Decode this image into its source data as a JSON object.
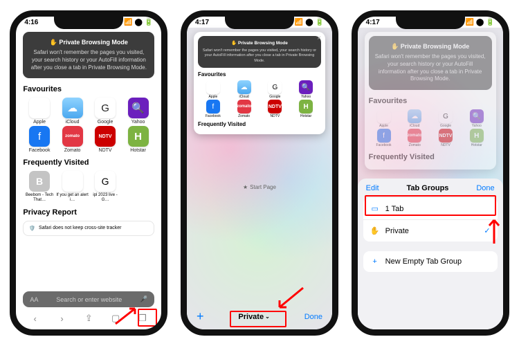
{
  "phone1": {
    "time": "4:16",
    "pbm": {
      "title": "✋ Private Browsing Mode",
      "body": "Safari won't remember the pages you visited, your search history or your AutoFill information after you close a tab in Private Browsing Mode."
    },
    "favourites_heading": "Favourites",
    "favourites": [
      {
        "label": "Apple",
        "glyph": ""
      },
      {
        "label": "iCloud",
        "glyph": "☁"
      },
      {
        "label": "Google",
        "glyph": "G"
      },
      {
        "label": "Yahoo",
        "glyph": "🔍"
      },
      {
        "label": "Facebook",
        "glyph": "f"
      },
      {
        "label": "Zomato",
        "glyph": "zomato"
      },
      {
        "label": "NDTV",
        "glyph": "NDTV"
      },
      {
        "label": "Hotstar",
        "glyph": "H"
      }
    ],
    "freq_heading": "Frequently Visited",
    "freq": [
      {
        "label": "Beebom - Tech That…",
        "glyph": "B"
      },
      {
        "label": "If you get an alert i…",
        "glyph": ""
      },
      {
        "label": "ipl 2023 live - G…",
        "glyph": "G"
      }
    ],
    "privacy_heading": "Privacy Report",
    "privacy_row": "Safari does not keep cross-site tracker",
    "search_placeholder": "Search or enter website"
  },
  "phone2": {
    "time": "4:17",
    "pbm": {
      "title": "✋ Private Browsing Mode",
      "body": "Safari won't remember the pages you visited, your search history or your AutoFill information after you close a tab in Private Browsing Mode."
    },
    "favourites_heading": "Favourites",
    "favourites": [
      {
        "label": "Apple",
        "glyph": ""
      },
      {
        "label": "iCloud",
        "glyph": "☁"
      },
      {
        "label": "Google",
        "glyph": "G"
      },
      {
        "label": "Yahoo",
        "glyph": "🔍"
      },
      {
        "label": "Facebook",
        "glyph": "f"
      },
      {
        "label": "Zomato",
        "glyph": "zomato"
      },
      {
        "label": "NDTV",
        "glyph": "NDTV"
      },
      {
        "label": "Hotstar",
        "glyph": "H"
      }
    ],
    "freq_heading": "Frequently Visited",
    "start_page": "Start Page",
    "bottom": {
      "plus": "+",
      "center": "Private",
      "done": "Done"
    }
  },
  "phone3": {
    "time": "4:17",
    "sheet": {
      "edit": "Edit",
      "title": "Tab Groups",
      "done": "Done",
      "rows": [
        {
          "icon": "▭",
          "label": "1 Tab",
          "checked": false
        },
        {
          "icon": "✋",
          "label": "Private",
          "checked": true
        }
      ],
      "new_row": {
        "icon": "+",
        "label": "New Empty Tab Group"
      }
    }
  }
}
